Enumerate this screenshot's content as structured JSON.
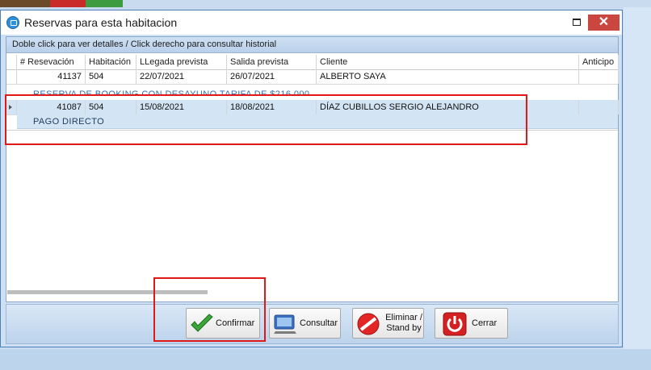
{
  "window": {
    "title": "Reservas para esta habitacion",
    "maximize_icon": "maximize-icon",
    "close_glyph": "✕"
  },
  "hint": "Doble click para ver detalles / Click derecho para consultar historial",
  "table": {
    "columns": [
      "# Resevación",
      "Habitación",
      "LLegada prevista",
      "Salida prevista",
      "Cliente",
      "Anticipo"
    ],
    "rows": [
      {
        "id": "41137",
        "room": "504",
        "arrival": "22/07/2021",
        "departure": "26/07/2021",
        "client": "ALBERTO SAYA",
        "deposit": "",
        "note": "RESERVA  DE  BOOKING  CON  DESAYUNO  TARIFA  DE $216.000"
      },
      {
        "id": "41087",
        "room": "504",
        "arrival": "15/08/2021",
        "departure": "18/08/2021",
        "client": "DÍAZ CUBILLOS SERGIO ALEJANDRO",
        "deposit": "",
        "note": "PAGO  DIRECTO",
        "selected": true
      }
    ]
  },
  "toolbar": {
    "confirm_label": "Confirmar",
    "consult_label": "Consultar",
    "delete_label_1": "Eliminar /",
    "delete_label_2": "Stand by",
    "close_label": "Cerrar"
  },
  "colors": {
    "selection": "#d3e5f4",
    "highlight": "#e01818",
    "close_button": "#c9473e"
  }
}
